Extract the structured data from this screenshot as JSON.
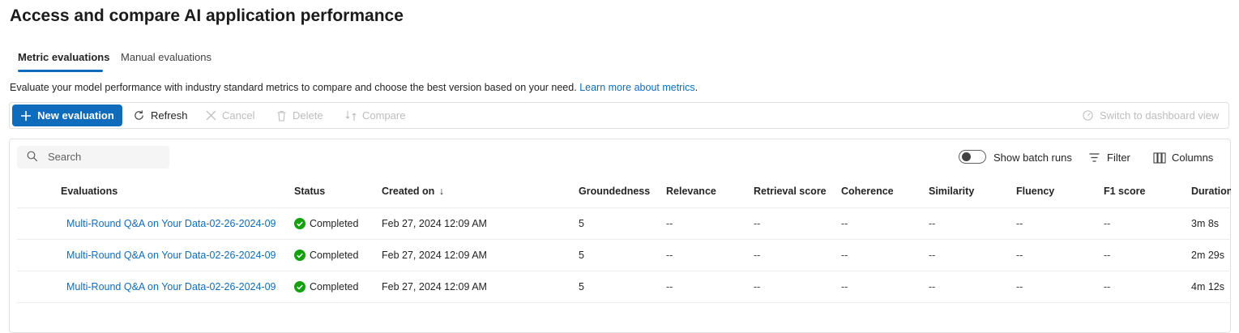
{
  "page": {
    "title": "Access and compare AI application performance"
  },
  "tabs": [
    {
      "label": "Metric evaluations",
      "active": true
    },
    {
      "label": "Manual evaluations",
      "active": false
    }
  ],
  "description": {
    "text": "Evaluate your model performance with industry standard metrics to compare and choose the best version based on your need.",
    "link": "Learn more about metrics",
    "suffix": "."
  },
  "toolbar": {
    "new_evaluation": "New evaluation",
    "refresh": "Refresh",
    "cancel": "Cancel",
    "delete": "Delete",
    "compare": "Compare",
    "switch_view": "Switch to dashboard view"
  },
  "search": {
    "placeholder": "Search",
    "value": ""
  },
  "batch_runs": {
    "label": "Show batch runs",
    "on": false
  },
  "filter_label": "Filter",
  "columns_label": "Columns",
  "table": {
    "headers": {
      "evaluations": "Evaluations",
      "status": "Status",
      "created_on": "Created on",
      "sort_indicator": "↓",
      "groundedness": "Groundedness",
      "relevance": "Relevance",
      "retrieval_score": "Retrieval score",
      "coherence": "Coherence",
      "similarity": "Similarity",
      "fluency": "Fluency",
      "f1_score": "F1 score",
      "duration": "Duration"
    },
    "rows": [
      {
        "evaluation": "Multi-Round Q&A on Your Data-02-26-2024-09",
        "status": "Completed",
        "created_on": "Feb 27, 2024 12:09 AM",
        "groundedness": "5",
        "relevance": "--",
        "retrieval_score": "--",
        "coherence": "--",
        "similarity": "--",
        "fluency": "--",
        "f1_score": "--",
        "duration": "3m 8s"
      },
      {
        "evaluation": "Multi-Round Q&A on Your Data-02-26-2024-09",
        "status": "Completed",
        "created_on": "Feb 27, 2024 12:09 AM",
        "groundedness": "5",
        "relevance": "--",
        "retrieval_score": "--",
        "coherence": "--",
        "similarity": "--",
        "fluency": "--",
        "f1_score": "--",
        "duration": "2m 29s"
      },
      {
        "evaluation": "Multi-Round Q&A on Your Data-02-26-2024-09",
        "status": "Completed",
        "created_on": "Feb 27, 2024 12:09 AM",
        "groundedness": "5",
        "relevance": "--",
        "retrieval_score": "--",
        "coherence": "--",
        "similarity": "--",
        "fluency": "--",
        "f1_score": "--",
        "duration": "4m 12s"
      }
    ]
  },
  "colors": {
    "accent": "#0f6cbd",
    "success": "#13a10e",
    "disabled": "#bdbdbd"
  }
}
